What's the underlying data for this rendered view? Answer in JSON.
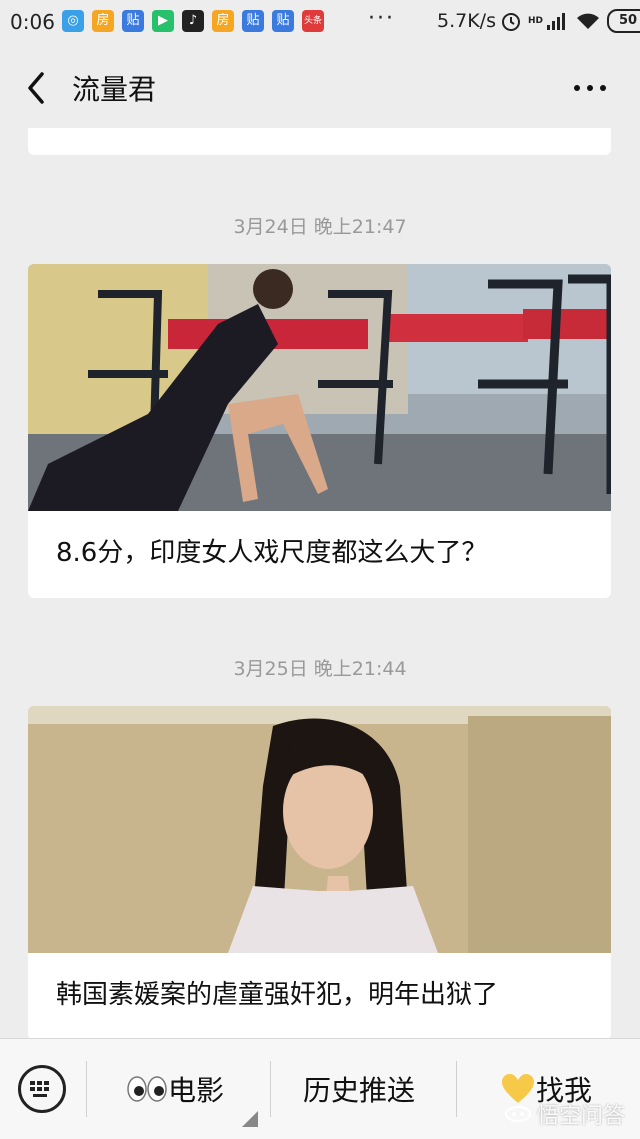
{
  "status": {
    "time": "0:06",
    "app_icons": [
      "房",
      "贴",
      "▶",
      "♪",
      "房",
      "贴",
      "贴",
      "头条"
    ],
    "more": "···",
    "speed": "5.7K/s",
    "hd": "HD",
    "battery": "50"
  },
  "nav": {
    "title": "流量君"
  },
  "feed": [
    {
      "timestamp": "3月24日 晚上21:47",
      "title": "8.6分，印度女人戏尺度都这么大了？",
      "image": "photo-woman-in-black-dress-cafe"
    },
    {
      "timestamp": "3月25日 晚上21:44",
      "title": "韩国素媛案的虐童强奸犯，明年出狱了",
      "image": "photo-injured-girl"
    }
  ],
  "menu": {
    "item1": "电影",
    "item2": "历史推送",
    "item3": "找我"
  },
  "watermark": "悟空问答",
  "colors": {
    "background": "#ededed",
    "card": "#ffffff",
    "timestamp": "#999999"
  }
}
